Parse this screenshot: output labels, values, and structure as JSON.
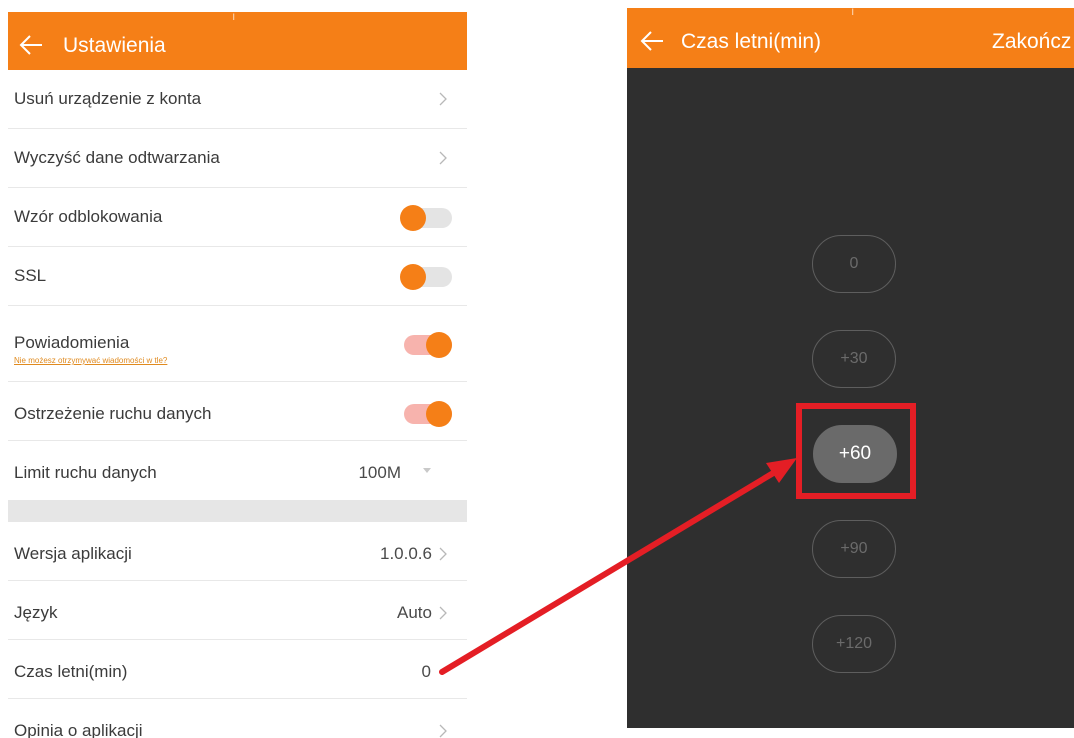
{
  "left": {
    "title": "Ustawienia",
    "rows": {
      "remove": "Usuń urządzenie z konta",
      "clear": "Wyczyść dane odtwarzania",
      "pattern": "Wzór odblokowania",
      "ssl": "SSL",
      "notifications": "Powiadomienia",
      "notifications_sub": "Nie możesz otrzymywać wiadomości w tle?",
      "traffic_warning": "Ostrzeżenie ruchu danych",
      "traffic_limit": "Limit ruchu danych",
      "traffic_limit_value": "100M",
      "version": "Wersja aplikacji",
      "version_value": "1.0.0.6",
      "language": "Język",
      "language_value": "Auto",
      "dst": "Czas letni(min)",
      "dst_value": "0",
      "feedback": "Opinia o aplikacji"
    },
    "toggles": {
      "pattern": false,
      "ssl": false,
      "notifications": true,
      "traffic_warning": true
    }
  },
  "right": {
    "title": "Czas letni(min)",
    "done": "Zakończ",
    "options": [
      "0",
      "+30",
      "+60",
      "+90",
      "+120"
    ],
    "selected": "+60"
  },
  "colors": {
    "accent": "#f57f17",
    "highlight": "#e41e25",
    "dark_bg": "#2f2f2f"
  }
}
